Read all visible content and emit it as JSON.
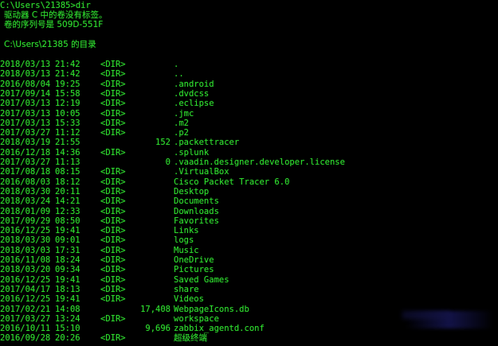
{
  "prompt": "C:\\Users\\21385>dir",
  "volume_line": "驱动器 C 中的卷没有标签。",
  "serial_line": "卷的序列号是 509D-551F",
  "directory_header": "C:\\Users\\21385 的目录",
  "entries": [
    {
      "date": "2018/03/13",
      "time": "21:42",
      "dir": "<DIR>",
      "size": "",
      "name": "."
    },
    {
      "date": "2018/03/13",
      "time": "21:42",
      "dir": "<DIR>",
      "size": "",
      "name": ".."
    },
    {
      "date": "2016/08/04",
      "time": "19:25",
      "dir": "<DIR>",
      "size": "",
      "name": ".android"
    },
    {
      "date": "2017/09/14",
      "time": "15:58",
      "dir": "<DIR>",
      "size": "",
      "name": ".dvdcss"
    },
    {
      "date": "2017/03/13",
      "time": "12:19",
      "dir": "<DIR>",
      "size": "",
      "name": ".eclipse"
    },
    {
      "date": "2017/03/13",
      "time": "10:05",
      "dir": "<DIR>",
      "size": "",
      "name": ".jmc"
    },
    {
      "date": "2017/03/13",
      "time": "15:33",
      "dir": "<DIR>",
      "size": "",
      "name": ".m2"
    },
    {
      "date": "2017/03/27",
      "time": "11:12",
      "dir": "<DIR>",
      "size": "",
      "name": ".p2"
    },
    {
      "date": "2018/03/19",
      "time": "21:55",
      "dir": "",
      "size": "152",
      "name": ".packettracer"
    },
    {
      "date": "2016/12/18",
      "time": "14:36",
      "dir": "<DIR>",
      "size": "",
      "name": ".splunk"
    },
    {
      "date": "2017/03/27",
      "time": "11:13",
      "dir": "",
      "size": "0",
      "name": ".vaadin.designer.developer.license"
    },
    {
      "date": "2017/08/18",
      "time": "08:15",
      "dir": "<DIR>",
      "size": "",
      "name": ".VirtualBox"
    },
    {
      "date": "2016/08/03",
      "time": "18:12",
      "dir": "<DIR>",
      "size": "",
      "name": "Cisco Packet Tracer 6.0"
    },
    {
      "date": "2018/03/30",
      "time": "20:11",
      "dir": "<DIR>",
      "size": "",
      "name": "Desktop"
    },
    {
      "date": "2018/03/24",
      "time": "14:21",
      "dir": "<DIR>",
      "size": "",
      "name": "Documents"
    },
    {
      "date": "2018/01/09",
      "time": "12:33",
      "dir": "<DIR>",
      "size": "",
      "name": "Downloads"
    },
    {
      "date": "2017/09/29",
      "time": "08:50",
      "dir": "<DIR>",
      "size": "",
      "name": "Favorites"
    },
    {
      "date": "2016/12/25",
      "time": "19:41",
      "dir": "<DIR>",
      "size": "",
      "name": "Links"
    },
    {
      "date": "2018/03/30",
      "time": "09:01",
      "dir": "<DIR>",
      "size": "",
      "name": "logs"
    },
    {
      "date": "2018/03/03",
      "time": "17:31",
      "dir": "<DIR>",
      "size": "",
      "name": "Music"
    },
    {
      "date": "2016/11/08",
      "time": "18:24",
      "dir": "<DIR>",
      "size": "",
      "name": "OneDrive"
    },
    {
      "date": "2018/03/20",
      "time": "09:34",
      "dir": "<DIR>",
      "size": "",
      "name": "Pictures"
    },
    {
      "date": "2016/12/25",
      "time": "19:41",
      "dir": "<DIR>",
      "size": "",
      "name": "Saved Games"
    },
    {
      "date": "2017/04/17",
      "time": "18:13",
      "dir": "<DIR>",
      "size": "",
      "name": "share"
    },
    {
      "date": "2016/12/25",
      "time": "19:41",
      "dir": "<DIR>",
      "size": "",
      "name": "Videos"
    },
    {
      "date": "2017/02/21",
      "time": "14:08",
      "dir": "",
      "size": "17,408",
      "name": "WebpageIcons.db"
    },
    {
      "date": "2017/03/27",
      "time": "13:24",
      "dir": "<DIR>",
      "size": "",
      "name": "workspace"
    },
    {
      "date": "2016/10/11",
      "time": "15:10",
      "dir": "",
      "size": "9,696",
      "name": "zabbix_agentd.conf"
    },
    {
      "date": "2016/09/28",
      "time": "20:26",
      "dir": "<DIR>",
      "size": "",
      "name": "超级终端"
    }
  ],
  "colors": {
    "background": "#000000",
    "text": "#2fe02f"
  }
}
